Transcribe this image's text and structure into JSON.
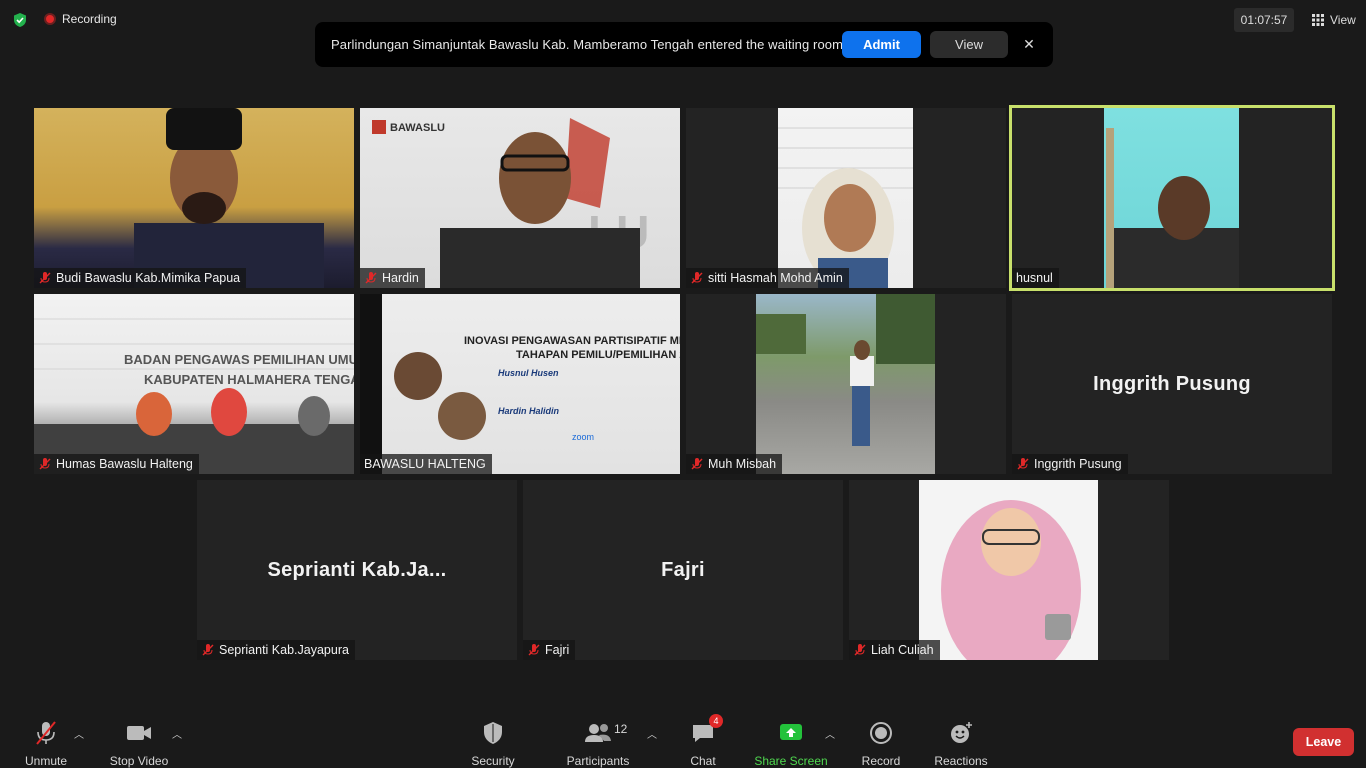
{
  "topbar": {
    "recording_label": "Recording",
    "timer": "01:07:57",
    "view_label": "View"
  },
  "notification": {
    "text": "Parlindungan Simanjuntak Bawaslu Kab. Mamberamo Tengah entered the waiting room",
    "admit_label": "Admit",
    "view_label": "View",
    "close_glyph": "✕"
  },
  "tiles": [
    {
      "name": "Budi Bawaslu Kab.Mimika Papua",
      "muted": true
    },
    {
      "name": "Hardin",
      "muted": true
    },
    {
      "name": "sitti Hasmah Mohd Amin",
      "muted": true
    },
    {
      "name": "husnul",
      "muted": false,
      "active": true
    },
    {
      "name": "Humas Bawaslu Halteng",
      "muted": true
    },
    {
      "name": "BAWASLU HALTENG",
      "muted": false
    },
    {
      "name": "Muh Misbah",
      "muted": true
    },
    {
      "name": "Inggrith Pusung",
      "display_name": "Inggrith Pusung",
      "muted": true
    },
    {
      "name": "Seprianti Kab.Jayapura",
      "display_name": "Seprianti  Kab.Ja...",
      "muted": true
    },
    {
      "name": "Fajri",
      "display_name": "Fajri",
      "muted": true
    },
    {
      "name": "Liah Culiah",
      "muted": true
    }
  ],
  "toolbar": {
    "unmute": "Unmute",
    "stop_video": "Stop Video",
    "security": "Security",
    "participants": "Participants",
    "participants_count": "12",
    "chat": "Chat",
    "chat_badge": "4",
    "share_screen": "Share Screen",
    "record": "Record",
    "reactions": "Reactions",
    "leave": "Leave"
  },
  "colors": {
    "accent_blue": "#0e72ed",
    "active_speaker": "#c8e06b",
    "leave_red": "#d13030",
    "share_green": "#4fd84f"
  }
}
